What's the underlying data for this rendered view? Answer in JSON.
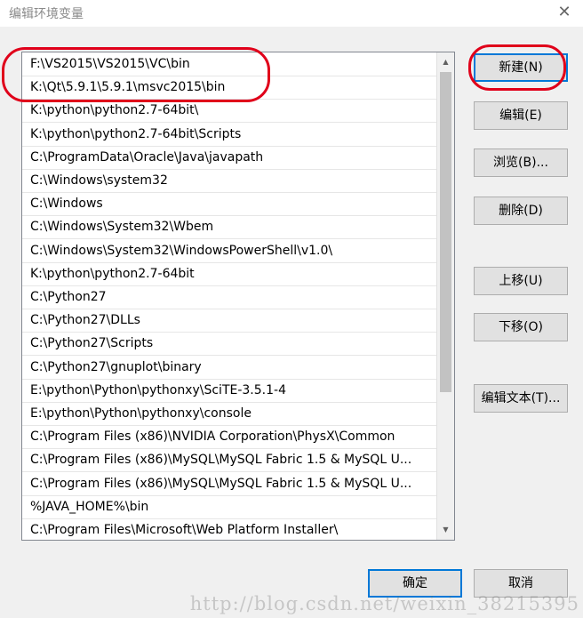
{
  "window": {
    "title": "编辑环境变量",
    "close_glyph": "✕"
  },
  "list": {
    "items": [
      "F:\\VS2015\\VS2015\\VC\\bin",
      "K:\\Qt\\5.9.1\\5.9.1\\msvc2015\\bin",
      "K:\\python\\python2.7-64bit\\",
      "K:\\python\\python2.7-64bit\\Scripts",
      "C:\\ProgramData\\Oracle\\Java\\javapath",
      "C:\\Windows\\system32",
      "C:\\Windows",
      "C:\\Windows\\System32\\Wbem",
      "C:\\Windows\\System32\\WindowsPowerShell\\v1.0\\",
      "K:\\python\\python2.7-64bit",
      "C:\\Python27",
      "C:\\Python27\\DLLs",
      "C:\\Python27\\Scripts",
      "C:\\Python27\\gnuplot\\binary",
      "E:\\python\\Python\\pythonxy\\SciTE-3.5.1-4",
      "E:\\python\\Python\\pythonxy\\console",
      "C:\\Program Files (x86)\\NVIDIA Corporation\\PhysX\\Common",
      "C:\\Program Files (x86)\\MySQL\\MySQL Fabric 1.5 & MySQL U...",
      "C:\\Program Files (x86)\\MySQL\\MySQL Fabric 1.5 & MySQL U...",
      "%JAVA_HOME%\\bin",
      "C:\\Program Files\\Microsoft\\Web Platform Installer\\"
    ],
    "scroll_up_glyph": "▲",
    "scroll_down_glyph": "▼"
  },
  "buttons": {
    "new": "新建(N)",
    "edit": "编辑(E)",
    "browse": "浏览(B)...",
    "delete": "删除(D)",
    "move_up": "上移(U)",
    "move_down": "下移(O)",
    "edit_text": "编辑文本(T)...",
    "ok": "确定",
    "cancel": "取消"
  },
  "watermark": "http://blog.csdn.net/weixin_38215395"
}
